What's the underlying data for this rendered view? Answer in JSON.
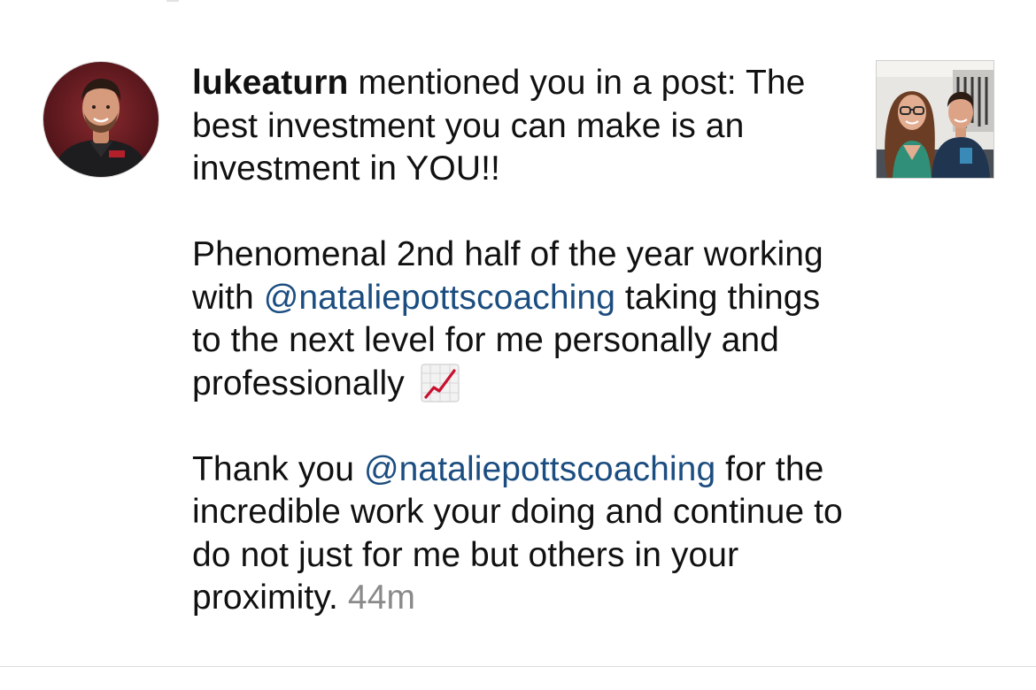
{
  "notification": {
    "username": "lukeaturn",
    "action_text": " mentioned you in a post:",
    "line_intro": "The best investment you can make is an investment in YOU!!",
    "paragraph2_text1": "Phenomenal 2nd half of the year working with ",
    "paragraph2_mention": "@nataliepottscoaching",
    "paragraph2_text2": " taking things to the next level for me personally and professionally",
    "paragraph2_emoji": "chart-increasing-emoji",
    "paragraph3_text1": "Thank you ",
    "paragraph3_mention": "@nataliepottscoaching",
    "paragraph3_text2": " for the incredible work your doing and continue to do not just for me but others in your proximity.",
    "timestamp": "44m",
    "avatar_icon": "profile-photo",
    "thumbnail_icon": "post-thumbnail"
  },
  "colors": {
    "mention": "#1b4d80",
    "timestamp": "#8a8a8a",
    "text": "#111111",
    "background": "#ffffff"
  }
}
